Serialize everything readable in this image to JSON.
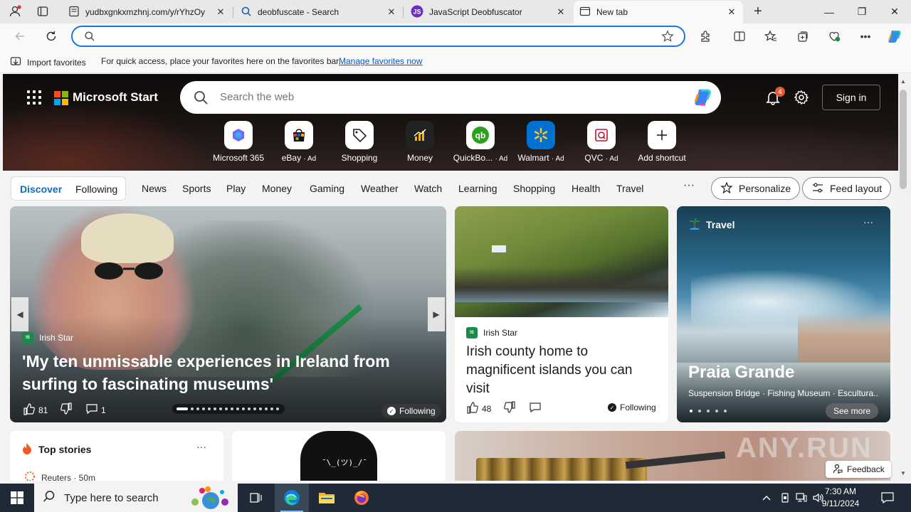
{
  "browser": {
    "tabs": [
      {
        "title": "yudbxgnkxmzhnj.com/y/rYhzOy",
        "icon": "page-icon",
        "active": false
      },
      {
        "title": "deobfuscate - Search",
        "icon": "search-icon",
        "active": false
      },
      {
        "title": "JavaScript Deobfuscator",
        "icon": "js-badge-icon",
        "active": false
      },
      {
        "title": "New tab",
        "icon": "newtab-icon",
        "active": true
      }
    ],
    "new_tab_label": "+",
    "address_value": "",
    "favbar": {
      "import_label": "Import favorites",
      "hint": "For quick access, place your favorites here on the favorites bar.",
      "manage_link": "Manage favorites now"
    }
  },
  "header": {
    "brand": "Microsoft Start",
    "search_placeholder": "Search the web",
    "notifications_count": "4",
    "signin_label": "Sign in"
  },
  "shortcuts": [
    {
      "label": "Microsoft 365",
      "ad": "",
      "icon": "m365-icon"
    },
    {
      "label": "eBay",
      "ad": "· Ad",
      "icon": "ebay-icon"
    },
    {
      "label": "Shopping",
      "ad": "",
      "icon": "shopping-tag-icon"
    },
    {
      "label": "Money",
      "ad": "",
      "icon": "money-chart-icon"
    },
    {
      "label": "QuickBo...",
      "ad": "· Ad",
      "icon": "quickbooks-icon"
    },
    {
      "label": "Walmart",
      "ad": "· Ad",
      "icon": "walmart-icon"
    },
    {
      "label": "QVC",
      "ad": "· Ad",
      "icon": "qvc-icon"
    },
    {
      "label": "Add shortcut",
      "ad": "",
      "icon": "plus-icon"
    }
  ],
  "nav": {
    "discover": "Discover",
    "following": "Following",
    "items": [
      "News",
      "Sports",
      "Play",
      "Money",
      "Gaming",
      "Weather",
      "Watch",
      "Learning",
      "Shopping",
      "Health",
      "Travel"
    ],
    "more": "···",
    "personalize": "Personalize",
    "feed_layout": "Feed layout"
  },
  "hero_story": {
    "source": "Irish Star",
    "title": "'My ten unmissable experiences in Ireland from surfing to fascinating museums'",
    "likes": "81",
    "comments": "1",
    "following": "Following",
    "slide_count": 17,
    "current_slide": 1
  },
  "island_story": {
    "source": "Irish Star",
    "title": "Irish county home to magnificent islands you can visit",
    "likes": "48",
    "following": "Following"
  },
  "travel_card": {
    "category": "Travel",
    "title": "Praia Grande",
    "subtitle": "Suspension Bridge · Fishing Museum · Escultura...",
    "see_more": "See more",
    "more": "···"
  },
  "top_stories": {
    "title": "Top stories",
    "more": "···",
    "first_source": "Reuters · 50m"
  },
  "hoodie_text": "¯\\_(ツ)_/¯",
  "watermark": "ANY.RUN",
  "feedback_label": "Feedback",
  "taskbar": {
    "search_placeholder": "Type here to search",
    "time": "7:30 AM",
    "date": "9/11/2024"
  },
  "colors": {
    "accent": "#0f6cbd",
    "address_focus": "#1a73e8",
    "notification_badge": "#e25c32",
    "taskbar": "#1f2a36"
  }
}
